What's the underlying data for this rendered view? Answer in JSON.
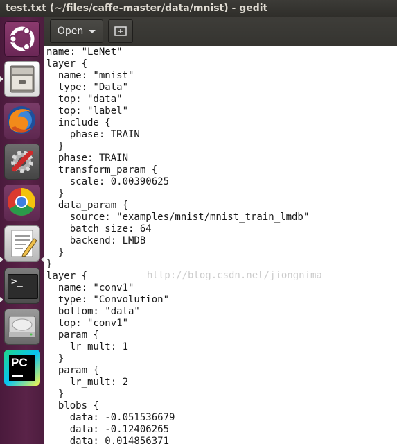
{
  "window": {
    "title": "test.txt (~/files/caffe-master/data/mnist) - gedit"
  },
  "toolbar": {
    "open_label": "Open"
  },
  "launcher": {
    "items": [
      {
        "name": "ubuntu-dash",
        "icon": "ubuntu-logo-icon"
      },
      {
        "name": "files",
        "icon": "file-cabinet-icon"
      },
      {
        "name": "firefox",
        "icon": "firefox-icon"
      },
      {
        "name": "system-settings",
        "icon": "settings-tools-icon"
      },
      {
        "name": "chrome",
        "icon": "chrome-icon"
      },
      {
        "name": "text-editor",
        "icon": "text-editor-icon"
      },
      {
        "name": "terminal",
        "icon": "terminal-icon"
      },
      {
        "name": "disk",
        "icon": "hard-drive-icon"
      },
      {
        "name": "pycharm",
        "icon": "pycharm-icon"
      }
    ],
    "terminal_prompt": ">_",
    "pycharm_label": "PC"
  },
  "editor": {
    "lines": [
      "name: \"LeNet\"",
      "layer {",
      "  name: \"mnist\"",
      "  type: \"Data\"",
      "  top: \"data\"",
      "  top: \"label\"",
      "  include {",
      "    phase: TRAIN",
      "  }",
      "  phase: TRAIN",
      "  transform_param {",
      "    scale: 0.00390625",
      "  }",
      "  data_param {",
      "    source: \"examples/mnist/mnist_train_lmdb\"",
      "    batch_size: 64",
      "    backend: LMDB",
      "  }",
      "}",
      "layer {",
      "  name: \"conv1\"",
      "  type: \"Convolution\"",
      "  bottom: \"data\"",
      "  top: \"conv1\"",
      "  param {",
      "    lr_mult: 1",
      "  }",
      "  param {",
      "    lr_mult: 2",
      "  }",
      "  blobs {",
      "    data: -0.051536679",
      "    data: -0.12406265",
      "    data: 0.014856371"
    ],
    "watermark": "http://blog.csdn.net/jiongnima"
  },
  "colors": {
    "titlebar": "#3c3b37",
    "launcher": "#5a2348",
    "toolbar": "#3e3d39",
    "editor_bg": "#ffffff"
  }
}
